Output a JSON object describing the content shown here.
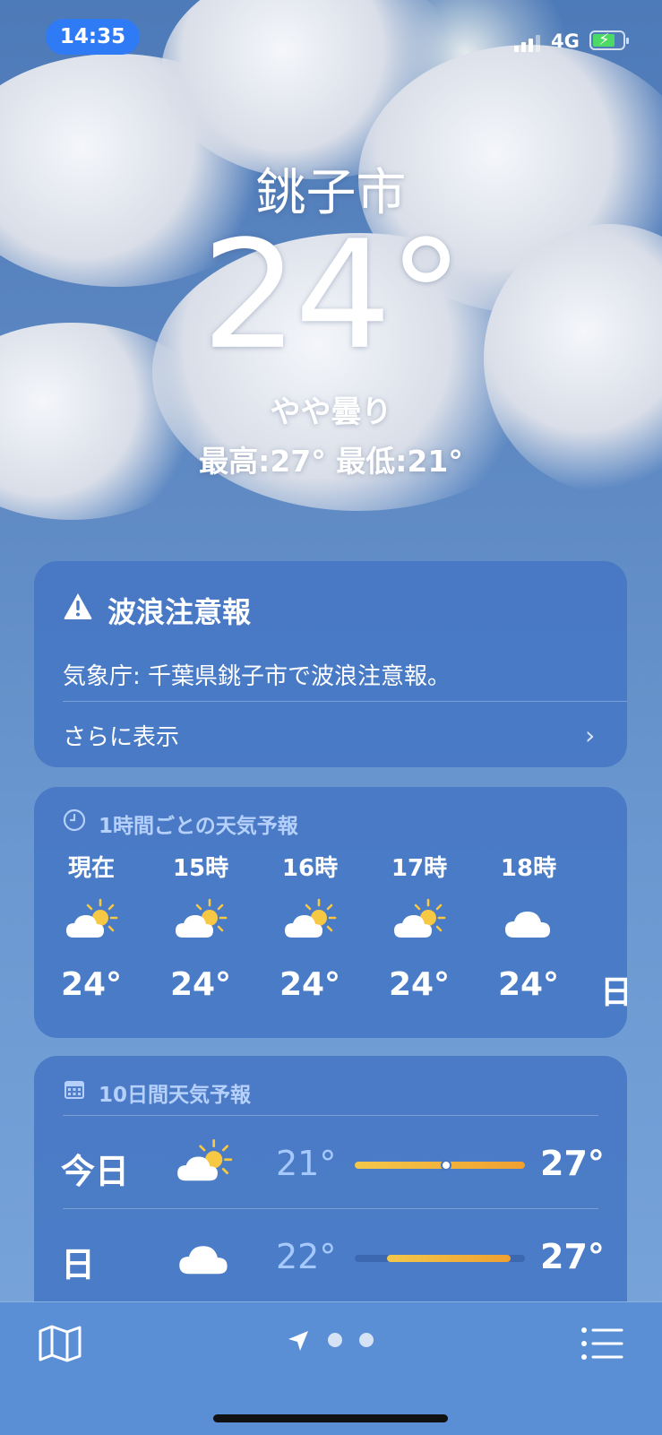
{
  "status": {
    "time": "14:35",
    "network": "4G"
  },
  "location": {
    "city": "銚子市",
    "temperature": "24°",
    "condition": "やや曇り",
    "high_low": "最高:27°  最低:21°"
  },
  "alert": {
    "title": "波浪注意報",
    "body": "気象庁: 千葉県銚子市で波浪注意報。",
    "more": "さらに表示",
    "icon": "warning-triangle-icon"
  },
  "hourly": {
    "heading": "1時間ごとの天気予報",
    "icon": "clock-icon",
    "items": [
      {
        "label": "現在",
        "icon": "partly-cloudy-icon",
        "temp": "24°"
      },
      {
        "label": "15時",
        "icon": "partly-cloudy-icon",
        "temp": "24°"
      },
      {
        "label": "16時",
        "icon": "partly-cloudy-icon",
        "temp": "24°"
      },
      {
        "label": "17時",
        "icon": "partly-cloudy-icon",
        "temp": "24°"
      },
      {
        "label": "18時",
        "icon": "cloud-icon",
        "temp": "24°"
      }
    ],
    "partial": "日"
  },
  "daily": {
    "heading": "10日間天気予報",
    "icon": "calendar-icon",
    "items": [
      {
        "day": "今日",
        "icon": "partly-cloudy-icon",
        "low": "21°",
        "high": "27°"
      },
      {
        "day": "日",
        "icon": "cloud-icon",
        "low": "22°",
        "high": "27°"
      }
    ]
  },
  "toolbar": {
    "map": "map-icon",
    "location": "location-arrow-icon",
    "list": "list-icon",
    "page_dots": 2
  },
  "colors": {
    "pill": "#2f7bf6",
    "card": "#4676c4",
    "bar_start": "#f3c84a",
    "bar_end": "#f0a030",
    "battery": "#4cd964"
  }
}
